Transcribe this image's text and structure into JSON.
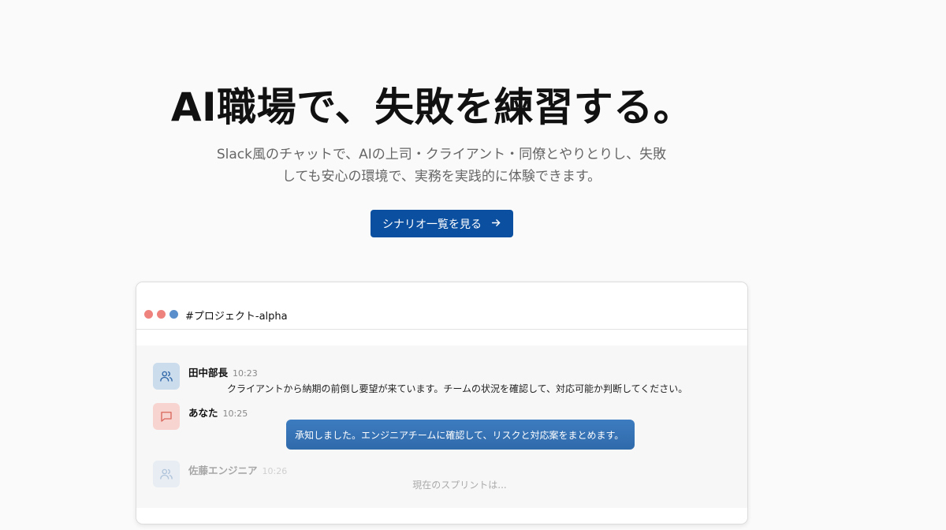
{
  "hero": {
    "title": "AI職場で、失敗を練習する。",
    "subtitle_line1": "Slack風のチャットで、AIの上司・クライアント・同僚とやりとりし、失敗",
    "subtitle_line2": "しても安心の環境で、実務を実践的に体験できます。",
    "cta_label": "シナリオ一覧を見る",
    "cta_icon": "arrow-right-icon",
    "cta_color": "#0b4fa0"
  },
  "chat_window": {
    "window_controls": [
      "close-dot",
      "minimize-dot",
      "maximize-dot"
    ],
    "channel": "#プロジェクト-alpha",
    "messages": [
      {
        "sender": "田中部長",
        "time": "10:23",
        "text": "クライアントから納期の前倒し要望が来ています。チームの状況を確認して、対応可能か判断してください。",
        "avatar_icon": "users-icon"
      },
      {
        "sender": "あなた",
        "time": "10:25",
        "text": "承知しました。エンジニアチームに確認して、リスクと対応案をまとめます。",
        "avatar_icon": "message-icon"
      },
      {
        "sender": "佐藤エンジニア",
        "time": "10:26",
        "text": "現在のスプリントは...",
        "avatar_icon": "users-icon"
      }
    ]
  }
}
